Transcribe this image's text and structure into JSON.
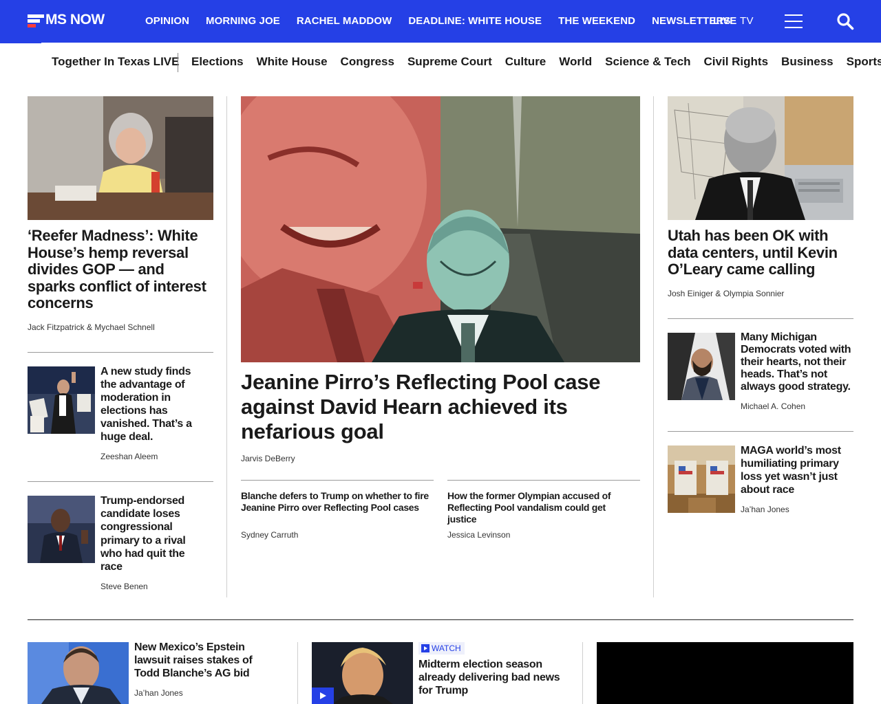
{
  "header": {
    "logo_text": "MS NOW",
    "nav": [
      "OPINION",
      "MORNING JOE",
      "RACHEL MADDOW",
      "DEADLINE: WHITE HOUSE",
      "THE WEEKEND",
      "NEWSLETTERS"
    ],
    "live_prefix": "LIVE",
    "live_suffix": "TV",
    "colors": {
      "brand_blue": "#2540e6",
      "logo_red": "#ff3b3b"
    }
  },
  "sections": {
    "special": "Together In Texas LIVE",
    "items": [
      "Elections",
      "White House",
      "Congress",
      "Supreme Court",
      "Culture",
      "World",
      "Science & Tech",
      "Civil Rights",
      "Business",
      "Sports"
    ]
  },
  "left": {
    "lead": {
      "headline": "‘Reefer Madness’: White House’s hemp reversal divides GOP — and sparks conflict of interest concerns",
      "byline": "Jack Fitzpatrick & Mychael Schnell"
    },
    "story2": {
      "headline": "A new study finds the advantage of moderation in elections has vanished. That’s a huge deal.",
      "byline": "Zeeshan Aleem"
    },
    "story3": {
      "headline": "Trump-endorsed candidate loses congressional primary to a rival who had quit the race",
      "byline": "Steve Benen"
    }
  },
  "center": {
    "main": {
      "headline": "Jeanine Pirro’s Reflecting Pool case against David Hearn achieved its nefarious goal",
      "byline": "Jarvis DeBerry"
    },
    "sub1": {
      "headline": "Blanche defers to Trump on whether to fire Jeanine Pirro over Reflecting Pool cases",
      "byline": "Sydney Carruth"
    },
    "sub2": {
      "headline": "How the former Olympian accused of Reflecting Pool vandalism could get justice",
      "byline": "Jessica Levinson"
    }
  },
  "right": {
    "lead": {
      "headline": "Utah has been OK with data centers, until Kevin O’Leary came calling",
      "byline": "Josh Einiger & Olympia Sonnier"
    },
    "story2": {
      "headline": "Many Michigan Democrats voted with their hearts, not their heads. That’s not always good strategy.",
      "byline": "Michael A. Cohen"
    },
    "story3": {
      "headline": "MAGA world’s most humiliating primary loss yet wasn’t just about race",
      "byline": "Ja’han Jones"
    }
  },
  "bottom": {
    "story1": {
      "headline": "New Mexico’s Epstein lawsuit raises stakes of Todd Blanche’s AG bid",
      "byline": "Ja’han Jones"
    },
    "story2": {
      "badge": "WATCH",
      "headline": "Midterm election season already delivering bad news for Trump"
    }
  }
}
